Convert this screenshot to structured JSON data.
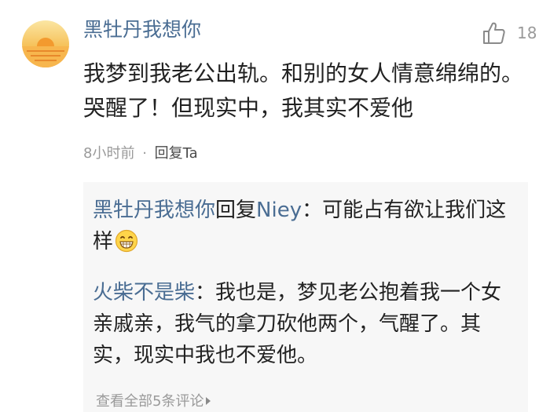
{
  "comment": {
    "username": "黑牡丹我想你",
    "like_count": "18",
    "text": "我梦到我老公出轨。和别的女人情意绵绵的。哭醒了！但现实中，我其实不爱他",
    "time": "8小时前",
    "separator": "·",
    "reply_label": "回复Ta"
  },
  "replies": [
    {
      "author": "黑牡丹我想你",
      "action": "回复",
      "target": "Niey",
      "text": "：可能占有欲让我们这样",
      "emoji": "grinning-emoji"
    },
    {
      "author": "火柴不是柴",
      "text": "：我也是，梦见老公抱着我一个女亲戚亲，我气的拿刀砍他两个，气醒了。其实，现实中我也不爱他。"
    }
  ],
  "view_all_label": "查看全部5条评论",
  "icons": {
    "avatar": "sunset-avatar",
    "like": "thumbs-up-icon",
    "more": "chevron-right-icon"
  },
  "colors": {
    "username": "#4a6d93",
    "text": "#222222",
    "muted": "#9a9a9a",
    "reply_background": "#f7f7f7"
  }
}
